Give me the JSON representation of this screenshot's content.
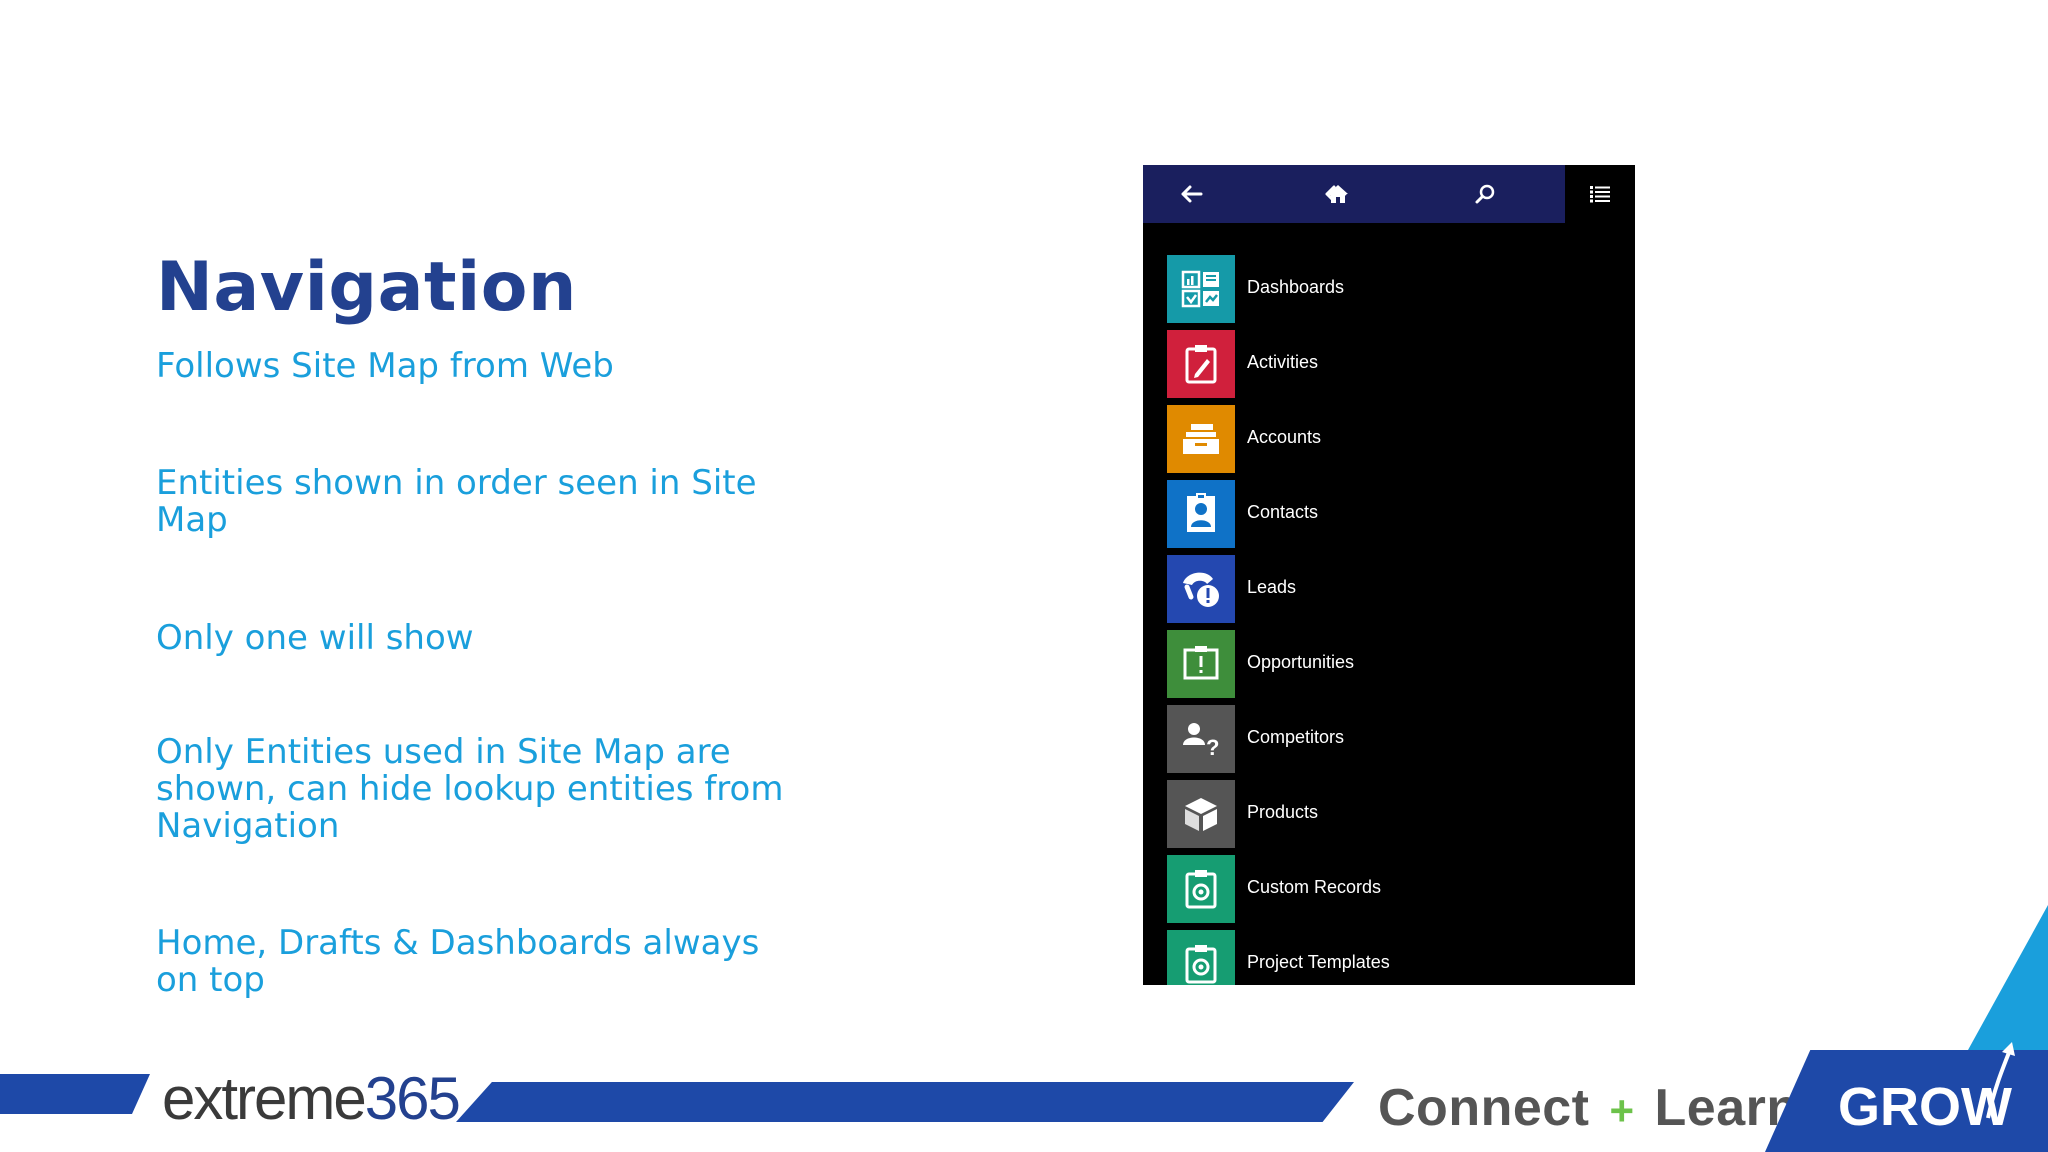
{
  "slide": {
    "title": "Navigation",
    "bullets": [
      "Follows Site Map from Web",
      "Entities shown in order seen in Site Map",
      "Only one will show",
      "Only Entities used in Site Map are shown, can hide lookup entities from Navigation",
      "Home, Drafts & Dashboards always on top"
    ]
  },
  "app": {
    "topbar": {
      "icons": [
        "back-arrow-icon",
        "home-icon",
        "search-icon",
        "list-menu-icon"
      ]
    },
    "nav_items": [
      {
        "label": "Dashboards",
        "color": "#159aa8",
        "icon": "dashboard-icon"
      },
      {
        "label": "Activities",
        "color": "#d0203c",
        "icon": "clipboard-pen-icon"
      },
      {
        "label": "Accounts",
        "color": "#e08a00",
        "icon": "folder-stack-icon"
      },
      {
        "label": "Contacts",
        "color": "#0f72c7",
        "icon": "contact-card-icon"
      },
      {
        "label": "Leads",
        "color": "#2448b0",
        "icon": "phone-alert-icon"
      },
      {
        "label": "Opportunities",
        "color": "#3e8e3b",
        "icon": "alert-board-icon"
      },
      {
        "label": "Competitors",
        "color": "#555555",
        "icon": "person-question-icon"
      },
      {
        "label": "Products",
        "color": "#555555",
        "icon": "box-icon"
      },
      {
        "label": "Custom Records",
        "color": "#169d72",
        "icon": "clipboard-gear-icon"
      },
      {
        "label": "Project Templates",
        "color": "#169d72",
        "icon": "clipboard-gear-icon"
      }
    ]
  },
  "footer": {
    "logo_text": "extreme",
    "logo_number": "365",
    "cta_connect": "Connect",
    "cta_plus": "+",
    "cta_learn": "Learn",
    "cta_equals": "=",
    "cta_grow": "GROW"
  }
}
